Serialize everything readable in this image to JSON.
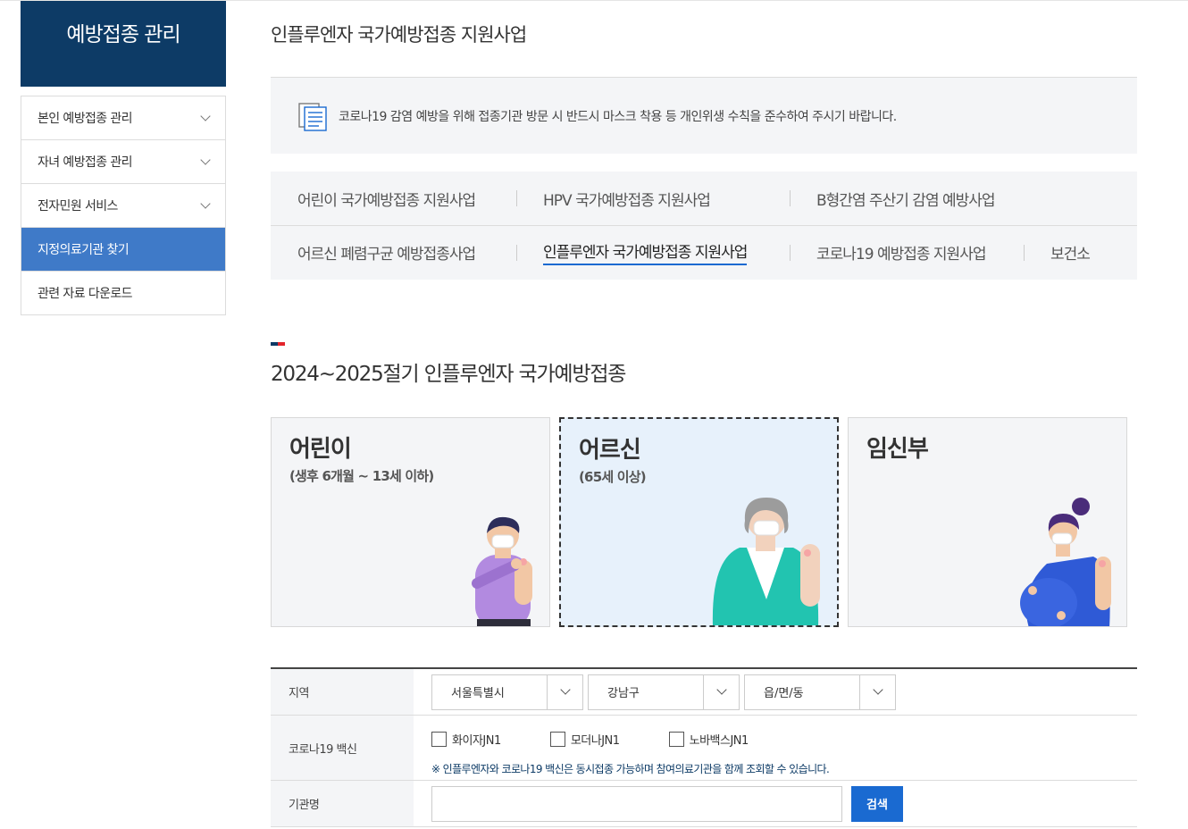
{
  "sidebar": {
    "title": "예방접종 관리",
    "items": [
      {
        "label": "본인 예방접종 관리"
      },
      {
        "label": "자녀 예방접종 관리"
      },
      {
        "label": "전자민원 서비스"
      },
      {
        "label": "지정의료기관 찾기"
      },
      {
        "label": "관련 자료 다운로드"
      }
    ]
  },
  "main": {
    "title": "인플루엔자 국가예방접종 지원사업",
    "notice": "코로나19 감염 예방을 위해 접종기관 방문 시 반드시 마스크 착용 등 개인위생 수칙을 준수하여 주시기 바랍니다.",
    "tabs": [
      {
        "label": "어린이 국가예방접종 지원사업"
      },
      {
        "label": "HPV 국가예방접종 지원사업"
      },
      {
        "label": "B형간염 주산기 감염 예방사업"
      },
      {
        "label": "어르신 폐렴구균 예방접종사업"
      },
      {
        "label": "인플루엔자 국가예방접종 지원사업"
      },
      {
        "label": "코로나19 예방접종 지원사업"
      },
      {
        "label": "보건소"
      }
    ],
    "section_title": "2024~2025절기 인플루엔자 국가예방접종",
    "cards": [
      {
        "name": "어린이",
        "sub": "(생후 6개월 ~ 13세 이하)"
      },
      {
        "name": "어르신",
        "sub": "(65세 이상)"
      },
      {
        "name": "임신부",
        "sub": ""
      }
    ]
  },
  "form": {
    "region_label": "지역",
    "region_selects": [
      "서울특별시",
      "강남구",
      "읍/면/동"
    ],
    "vaccine_label": "코로나19 백신",
    "vaccines": [
      "화이자JN1",
      "모더나JN1",
      "노바백스JN1"
    ],
    "vaccine_hint": "※ 인플루엔자와 코로나19 백신은 동시접종 가능하며 참여의료기관을 함께 조회할 수 있습니다.",
    "name_label": "기관명",
    "name_value": "",
    "search_button": "검색"
  },
  "colors": {
    "brand_navy": "#0d3b66",
    "active_blue": "#3f7ac8",
    "button_blue": "#1a6ad1"
  }
}
